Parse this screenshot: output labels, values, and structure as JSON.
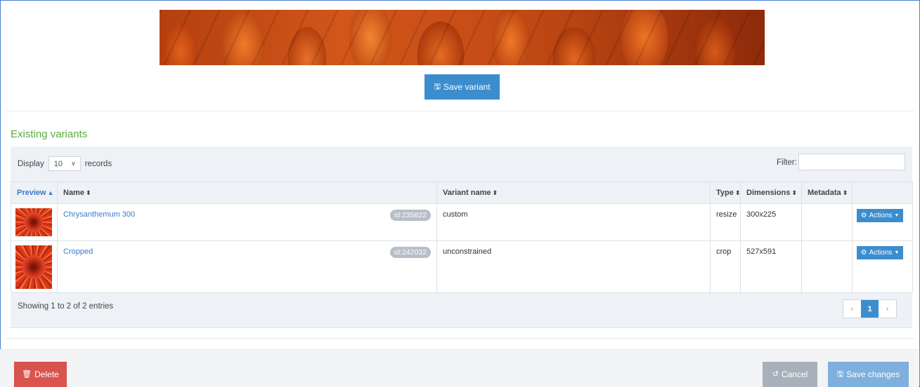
{
  "toolbar": {
    "save_variant_label": "Save variant",
    "save_icon": "floppy-disk-icon"
  },
  "section": {
    "title": "Existing variants"
  },
  "list_controls": {
    "display_label": "Display",
    "page_size": "10",
    "records_label": "records",
    "filter_label": "Filter:",
    "filter_value": ""
  },
  "table": {
    "headers": {
      "preview": "Preview",
      "name": "Name",
      "variant_name": "Variant name",
      "type": "Type",
      "dimensions": "Dimensions",
      "metadata": "Metadata"
    },
    "rows": [
      {
        "name": "Chrysanthemum 300",
        "id": "id:235822",
        "variant_name": "custom",
        "type": "resize",
        "dimensions": "300x225",
        "metadata": "",
        "actions_label": "Actions"
      },
      {
        "name": "Cropped",
        "id": "id:242032",
        "variant_name": "unconstrained",
        "type": "crop",
        "dimensions": "527x591",
        "metadata": "",
        "actions_label": "Actions"
      }
    ]
  },
  "pagination": {
    "summary": "Showing 1 to 2 of 2 entries",
    "prev": "‹",
    "current": "1",
    "next": "›"
  },
  "footer": {
    "delete_label": "Delete",
    "cancel_label": "Cancel",
    "save_changes_label": "Save changes"
  },
  "colors": {
    "primary": "#3c8dce",
    "danger": "#d9534f",
    "section_title": "#5aab3f",
    "muted": "#a8b1bb"
  }
}
